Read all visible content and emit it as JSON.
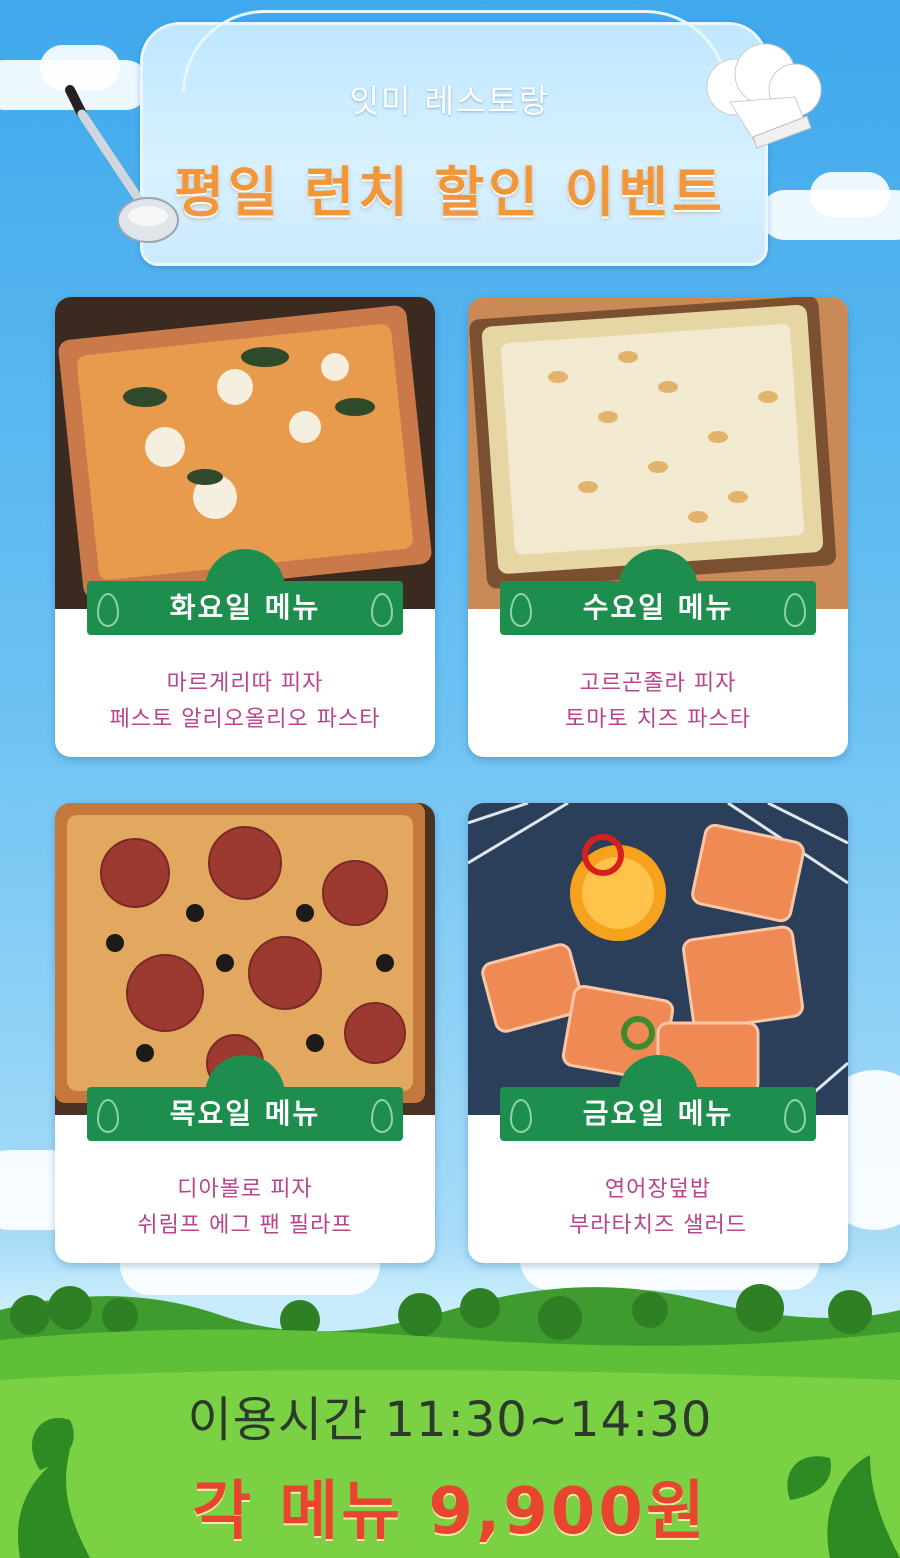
{
  "header": {
    "restaurant_name": "잇미 레스토랑",
    "event_title": "평일 런치 할인 이벤트"
  },
  "cards": [
    {
      "day_label": "화요일 메뉴",
      "items": [
        "마르게리따 피자",
        "페스토 알리오올리오 파스타"
      ],
      "photo": "margherita-pizza-photo"
    },
    {
      "day_label": "수요일 메뉴",
      "items": [
        "고르곤졸라 피자",
        "토마토 치즈 파스타"
      ],
      "photo": "gorgonzola-pizza-photo"
    },
    {
      "day_label": "목요일 메뉴",
      "items": [
        "디아볼로 피자",
        "쉬림프 에그 팬 필라프"
      ],
      "photo": "diavolo-pizza-photo"
    },
    {
      "day_label": "금요일 메뉴",
      "items": [
        "연어장덮밥",
        "부라타치즈 샐러드"
      ],
      "photo": "salmon-rice-bowl-photo"
    }
  ],
  "footer": {
    "hours": "이용시간 11:30~14:30",
    "price": "각 메뉴 9,900원"
  },
  "colors": {
    "badge_green": "#1e8e4e",
    "title_orange": "#f2963a",
    "menu_text": "#b8458e",
    "price_red": "#e8452e"
  }
}
